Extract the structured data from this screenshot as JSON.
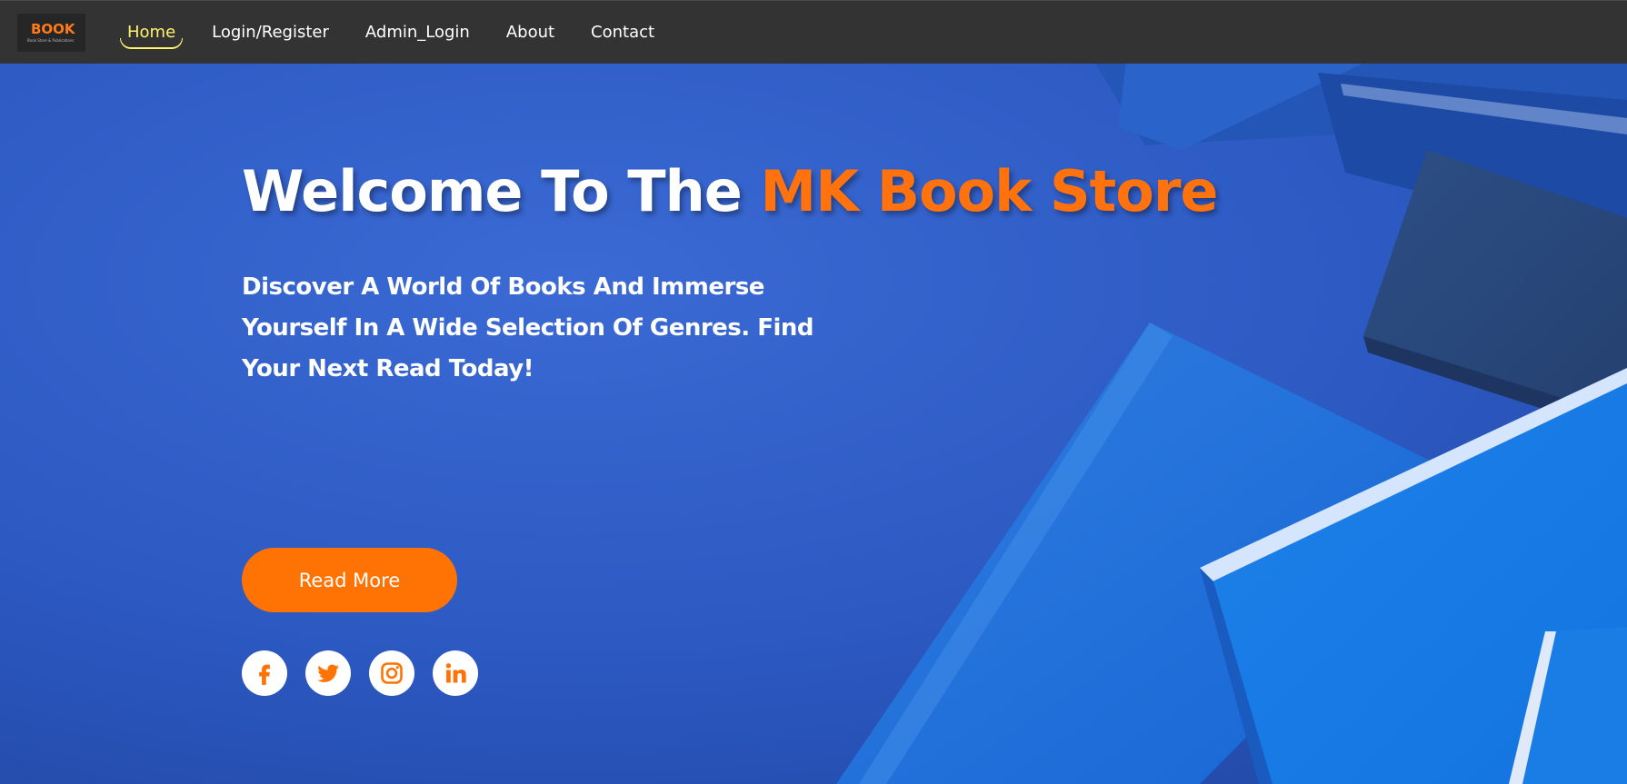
{
  "brand": {
    "logo_word": "BOOK",
    "logo_tagline": "Book Store & Publications",
    "accent_color": "#ff720d",
    "nav_bg": "#333333",
    "active_nav_color": "#fff36b"
  },
  "nav": {
    "items": [
      {
        "label": "Home",
        "active": true
      },
      {
        "label": "Login/Register",
        "active": false
      },
      {
        "label": "Admin_Login",
        "active": false
      },
      {
        "label": "About",
        "active": false
      },
      {
        "label": "Contact",
        "active": false
      }
    ]
  },
  "hero": {
    "title_main": "Welcome To The ",
    "title_accent": "MK Book Store",
    "subtitle": "Discover A World Of Books And Immerse Yourself In A Wide Selection Of Genres. Find Your Next Read Today!",
    "cta_label": "Read More",
    "background": "blue books on blue desk"
  },
  "socials": [
    {
      "icon": "facebook-icon"
    },
    {
      "icon": "twitter-icon"
    },
    {
      "icon": "instagram-icon"
    },
    {
      "icon": "linkedin-icon"
    }
  ]
}
